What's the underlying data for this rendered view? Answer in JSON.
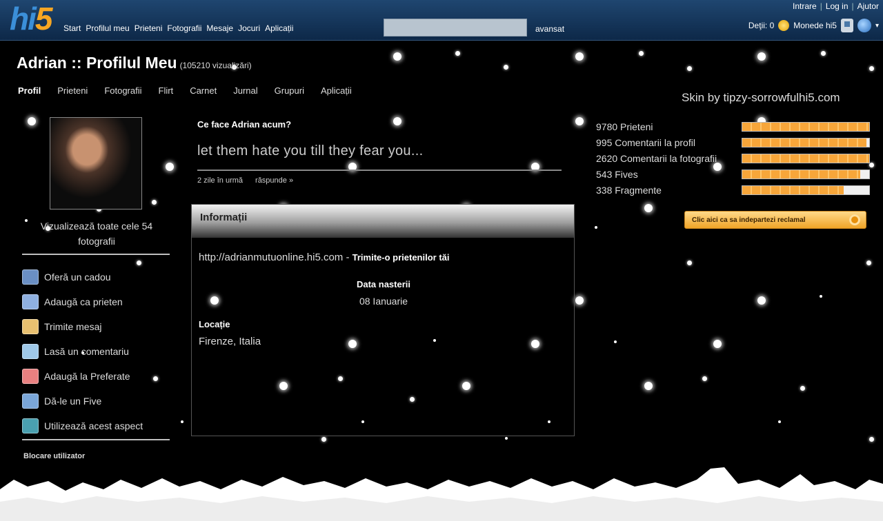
{
  "logo": {
    "hi": "hi",
    "five": "5"
  },
  "main_nav": [
    "Start",
    "Profilul meu",
    "Prieteni",
    "Fotografii",
    "Mesaje",
    "Jocuri",
    "Aplicații"
  ],
  "search": {
    "value": "",
    "advanced_label": "avansat"
  },
  "top_links": {
    "sign_in": "Intrare",
    "log_in": "Log in",
    "help": "Ajutor"
  },
  "wallet": {
    "owned_label": "Deţii: 0",
    "coins_label": "Monede hi5"
  },
  "profile": {
    "title": "Adrian :: Profilul Meu",
    "views": "(105210 vizualizări)",
    "tabs": [
      "Profil",
      "Prieteni",
      "Fotografii",
      "Flirt",
      "Carnet",
      "Jurnal",
      "Grupuri",
      "Aplicații"
    ],
    "active_tab": "Profil"
  },
  "skin_credit": "Skin by tipzy-sorrowfulhi5.com",
  "sidebar": {
    "view_photos": "Vizualizează toate cele 54 fotografii",
    "actions": [
      {
        "label": "Oferă un cadou",
        "icon": "gift-icon",
        "color": "#6a8fc4"
      },
      {
        "label": "Adaugă ca prieten",
        "icon": "add-friend-icon",
        "color": "#8fb0e0"
      },
      {
        "label": "Trimite mesaj",
        "icon": "envelope-icon",
        "color": "#e8c070"
      },
      {
        "label": "Lasă un comentariu",
        "icon": "comment-icon",
        "color": "#9fc8e8"
      },
      {
        "label": "Adaugă la Preferate",
        "icon": "heart-icon",
        "color": "#e88080"
      },
      {
        "label": "Dă-le un Five",
        "icon": "five-icon",
        "color": "#7aa6d8"
      },
      {
        "label": "Utilizează acest aspect",
        "icon": "star-icon",
        "color": "#4aa0b0"
      }
    ],
    "block_user": "Blocare utilizator"
  },
  "status": {
    "question": "Ce face Adrian acum?",
    "text": "let them hate you till they fear you...",
    "time": "2 zile în urmă",
    "reply": "răspunde »"
  },
  "info": {
    "title": "Informații",
    "url": "http://adrianmutuonline.hi5.com",
    "send_to_friends": "Trimite-o prietenilor tăi",
    "dob_label": "Data nasterii",
    "dob_value": "08 Ianuarie",
    "location_label": "Locație",
    "location_value": "Firenze, Italia"
  },
  "stats": [
    {
      "label": "9780 Prieteni",
      "fill": 1.0
    },
    {
      "label": "995 Comentarii la profil",
      "fill": 0.98
    },
    {
      "label": "2620 Comentarii la fotografii",
      "fill": 1.0
    },
    {
      "label": "543 Fives",
      "fill": 0.93
    },
    {
      "label": "338 Fragmente",
      "fill": 0.8
    }
  ],
  "remove_ads": "Clic aici ca sa indepartezi reclamal"
}
